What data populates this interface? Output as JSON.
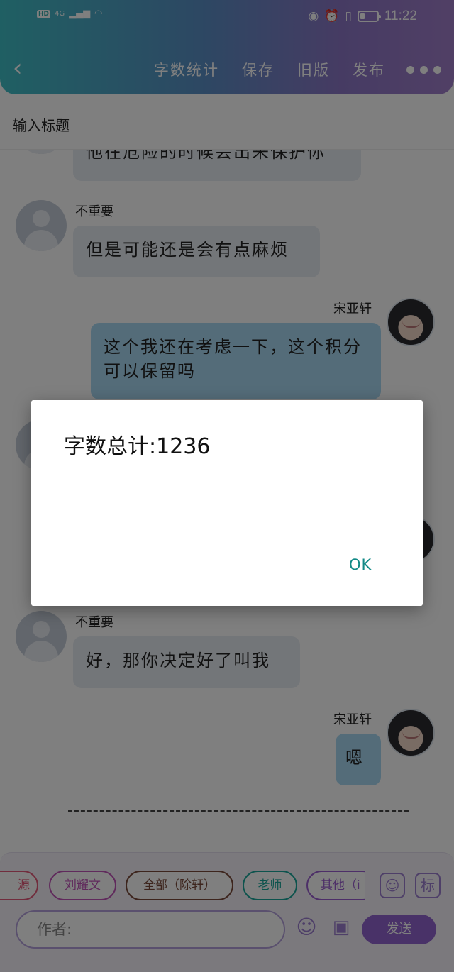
{
  "status_bar": {
    "network_label": "HD",
    "signal_label": "4G",
    "time": "11:22"
  },
  "header": {
    "menu": [
      "字数统计",
      "保存",
      "旧版",
      "发布"
    ]
  },
  "editor": {
    "title_placeholder": "输入标题"
  },
  "chat": [
    {
      "side": "left",
      "name": "",
      "text": "他在危险的时候会出来保护你"
    },
    {
      "side": "left",
      "name": "不重要",
      "text": "但是可能还是会有点麻烦"
    },
    {
      "side": "right",
      "name": "宋亚轩",
      "text": "这个我还在考虑一下，这个积分可以保留吗"
    },
    {
      "side": "left",
      "name": "不重要",
      "text": "好，那你决定好了叫我"
    },
    {
      "side": "right",
      "name": "宋亚轩",
      "text": "嗯"
    }
  ],
  "toolbar": {
    "tags": [
      {
        "label": "源",
        "color": "#e25b7a"
      },
      {
        "label": "刘耀文",
        "color": "#c154b8"
      },
      {
        "label": "全部（除轩）",
        "color": "#7a4a3a"
      },
      {
        "label": "老师",
        "color": "#1aa79a"
      },
      {
        "label": "其他（i",
        "color": "#9b5fd0"
      }
    ],
    "tag_icon_label": "标",
    "author_placeholder": "作者:",
    "send_label": "发送"
  },
  "dialog": {
    "message": "字数总计:1236",
    "ok_label": "OK"
  },
  "colors": {
    "accent_purple": "#9264d0",
    "ok_teal": "#138a87"
  }
}
